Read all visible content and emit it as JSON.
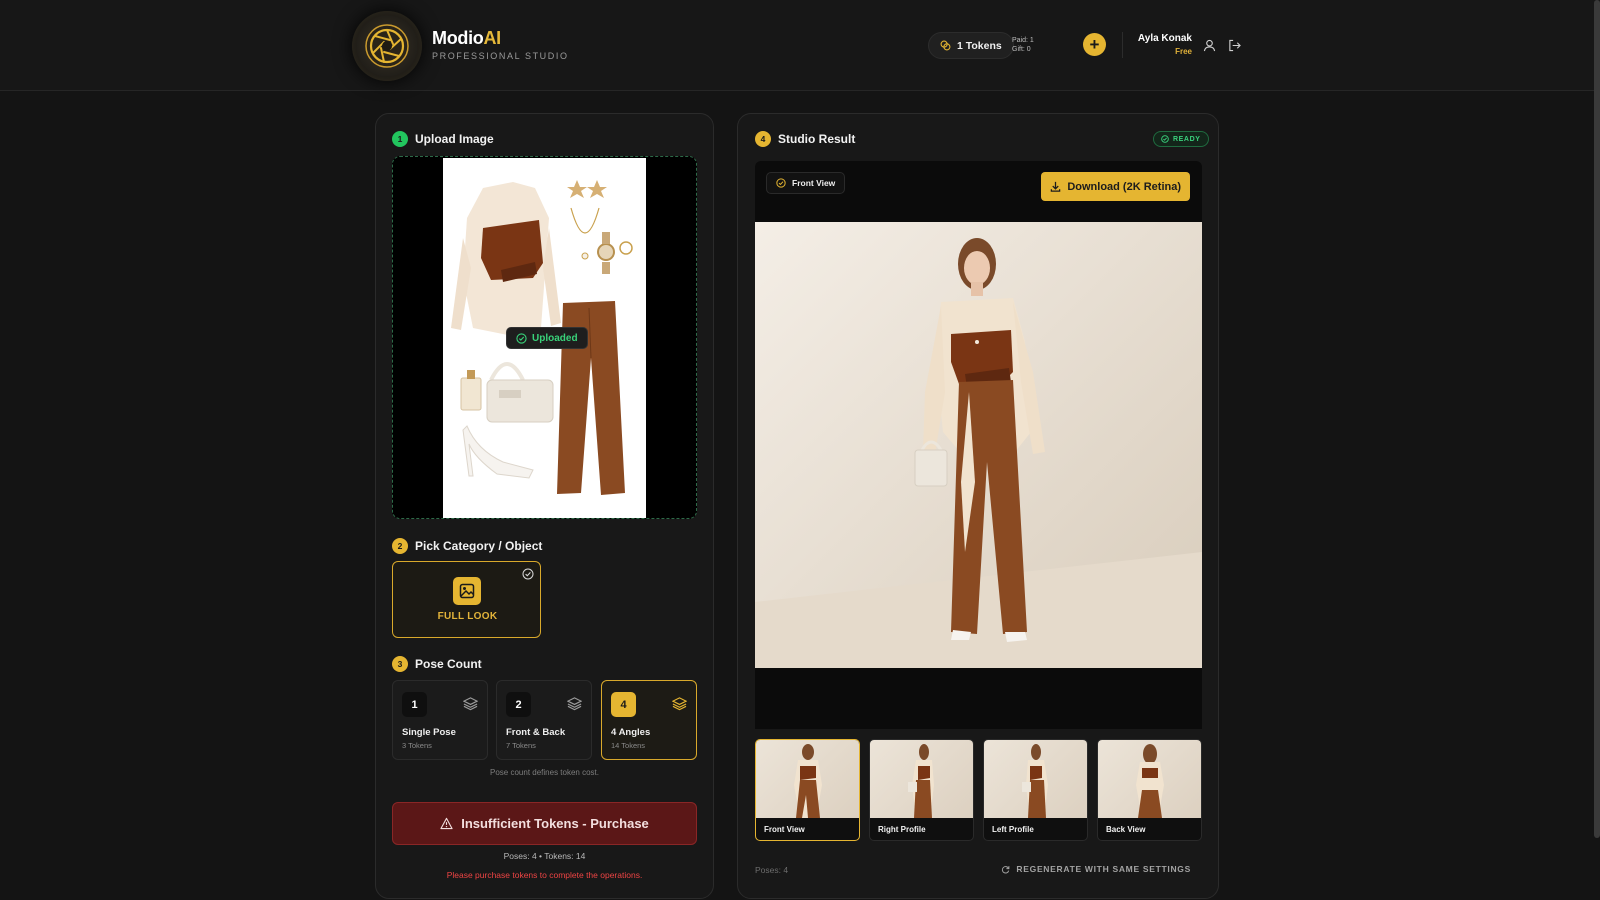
{
  "header": {
    "brand_main": "Modio",
    "brand_accent": "AI",
    "brand_subtitle": "PROFESSIONAL STUDIO",
    "tokens_label": "1 Tokens",
    "paid_label": "Paid: 1",
    "gift_label": "Gift: 0",
    "user_name": "Ayla Konak",
    "user_plan": "Free"
  },
  "upload": {
    "step_number": "1",
    "title": "Upload Image",
    "status_label": "Uploaded"
  },
  "category": {
    "step_number": "2",
    "title": "Pick Category / Object",
    "selected_label": "FULL LOOK"
  },
  "poses": {
    "step_number": "3",
    "title": "Pose Count",
    "options": [
      {
        "count": "1",
        "title": "Single Pose",
        "tokens": "3 Tokens",
        "selected": false
      },
      {
        "count": "2",
        "title": "Front & Back",
        "tokens": "7 Tokens",
        "selected": false
      },
      {
        "count": "4",
        "title": "4 Angles",
        "tokens": "14 Tokens",
        "selected": true
      }
    ],
    "note": "Pose count defines token cost."
  },
  "purchase": {
    "button_label": "Insufficient Tokens - Purchase",
    "summary": "Poses: 4 • Tokens: 14",
    "warning": "Please purchase tokens to complete the operations."
  },
  "result": {
    "step_number": "4",
    "title": "Studio Result",
    "status_badge": "READY",
    "current_view": "Front View",
    "download_label": "Download (2K Retina)",
    "thumbnails": [
      {
        "label": "Front View",
        "selected": true
      },
      {
        "label": "Right Profile",
        "selected": false
      },
      {
        "label": "Left Profile",
        "selected": false
      },
      {
        "label": "Back View",
        "selected": false
      }
    ],
    "poses_footer": "Poses: 4",
    "regenerate_label": "REGENERATE WITH SAME SETTINGS"
  },
  "colors": {
    "accent_gold": "#e5b531",
    "success_green": "#22c55e",
    "danger_red": "#ef4444",
    "background": "#141414"
  }
}
